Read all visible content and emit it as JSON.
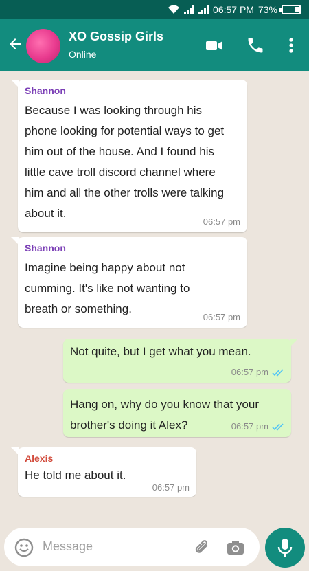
{
  "status_bar": {
    "time": "06:57 PM",
    "battery": "73%"
  },
  "header": {
    "title": "XO Gossip Girls",
    "status": "Online"
  },
  "messages": [
    {
      "sender": "Shannon",
      "text": " Because I was looking through his phone looking for potential ways to get him out of the house. And I found his little cave troll discord channel where him and all the other trolls were talking about it.",
      "time": "06:57 pm"
    },
    {
      "sender": "Shannon",
      "text": " Imagine being happy about not cumming. It's like not wanting to breath or something.",
      "time": "06:57 pm"
    },
    {
      "text": "Not quite, but I get what you mean.",
      "time": "06:57 pm"
    },
    {
      "text": "Hang on, why do you know that your brother's doing it Alex?",
      "time": "06:57 pm"
    },
    {
      "sender": "Alexis",
      "text": "He told me about it.",
      "time": "06:57 pm"
    }
  ],
  "input": {
    "placeholder": "Message"
  },
  "colors": {
    "header": "#128c7e",
    "status_bar": "#075e54",
    "shannon": "#7b3fb6",
    "alexis": "#d24b3c",
    "read_tick": "#4fc3f7"
  }
}
